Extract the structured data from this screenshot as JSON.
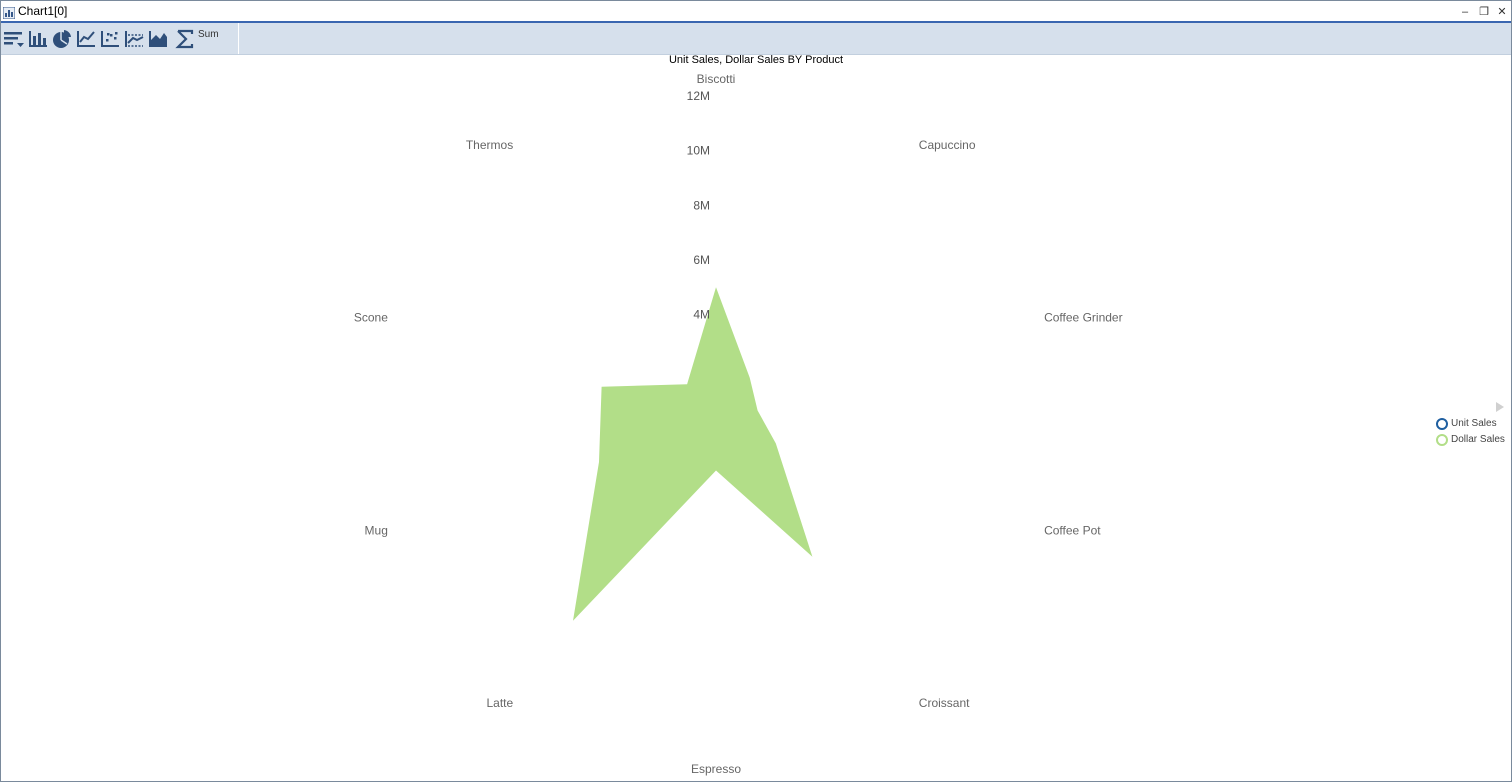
{
  "window": {
    "title": "Chart1[0]",
    "controls": {
      "minimize": "–",
      "restore": "❐",
      "close": "✕"
    }
  },
  "toolbar": {
    "buttons": [
      {
        "icon": "sort-icon"
      },
      {
        "icon": "bar-chart-icon"
      },
      {
        "icon": "pie-chart-icon"
      },
      {
        "icon": "line-chart-icon"
      },
      {
        "icon": "scatter-chart-icon"
      },
      {
        "icon": "reference-line-icon"
      },
      {
        "icon": "area-chart-icon"
      },
      {
        "icon": "sum-icon"
      }
    ],
    "sum_label": "Sum"
  },
  "chart_data": {
    "type": "radar",
    "title": "Unit Sales, Dollar Sales BY Product",
    "categories": [
      "Biscotti",
      "Capuccino",
      "Coffee Grinder",
      "Coffee Pot",
      "Croissant",
      "Espresso",
      "Latte",
      "Mug",
      "Scone",
      "Thermos"
    ],
    "axis_ticks": [
      "12M",
      "10M",
      "8M",
      "6M",
      "4M"
    ],
    "r_max": 12000000,
    "series": [
      {
        "name": "Dollar Sales",
        "color": "#b2de88",
        "values": [
          5000000,
          2100000,
          1600000,
          2300000,
          6000000,
          1700000,
          8900000,
          4500000,
          4400000,
          1800000
        ]
      },
      {
        "name": "Unit Sales",
        "color": "#1f5fa0",
        "values": [
          0,
          0,
          0,
          0,
          0,
          0,
          0,
          0,
          0,
          0
        ]
      }
    ],
    "legend": [
      {
        "label": "Unit Sales",
        "color": "#1f5fa0"
      },
      {
        "label": "Dollar Sales",
        "color": "#b2de88"
      }
    ],
    "legend_position": "right"
  }
}
